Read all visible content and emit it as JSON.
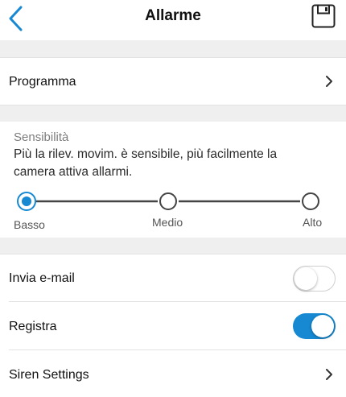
{
  "header": {
    "title": "Allarme",
    "back_icon": "chevron-left-icon",
    "save_icon": "save-icon",
    "accent_color": "#1689d2"
  },
  "schedule": {
    "label": "Programma",
    "icon": "chevron-right-icon"
  },
  "sensitivity": {
    "title": "Sensibilità",
    "description": "Più la rilev. movim. è sensibile, più facilmente la camera attiva allarmi.",
    "levels": [
      "Basso",
      "Medio",
      "Alto"
    ],
    "selected": "Basso"
  },
  "email": {
    "label": "Invia e-mail",
    "enabled": false
  },
  "record": {
    "label": "Registra",
    "enabled": true
  },
  "siren": {
    "label": "Siren Settings",
    "icon": "chevron-right-icon"
  }
}
